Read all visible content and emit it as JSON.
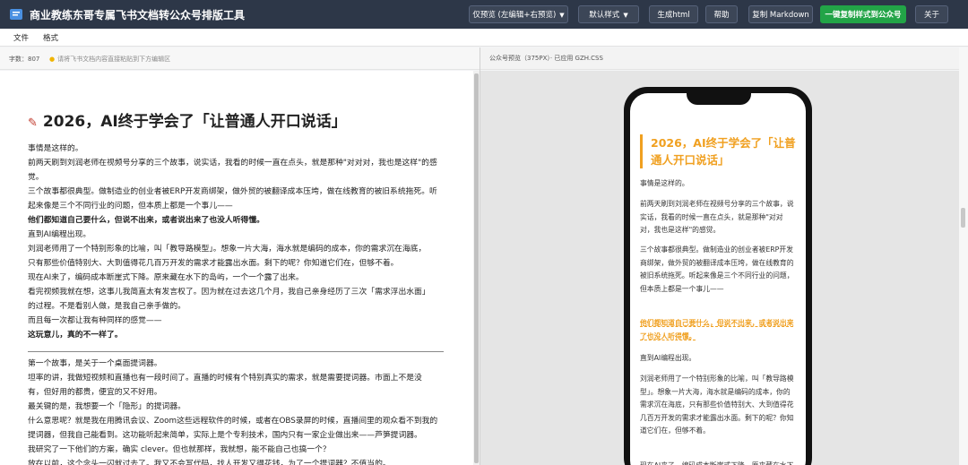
{
  "app": {
    "title": "商业教练东哥专属飞书文档转公众号排版工具"
  },
  "toolbar": {
    "preview_mode": "仅预览 (左编辑+右预览)",
    "style_select": "默认样式",
    "gen_html": "生成html",
    "help": "帮助",
    "copy_markdown": "复制 Markdown",
    "copy_to_wechat": "一键复制样式到公众号",
    "about": "关于"
  },
  "menu": {
    "file": "文件",
    "format": "格式"
  },
  "editor": {
    "word_count": "字数：807",
    "hint": "请将飞书文档内容直接粘贴到下方编辑区",
    "title": "2026，AI终于学会了「让普通人开口说话」",
    "lines_a": [
      {
        "text": "事情是这样的。",
        "bold": false
      },
      {
        "text": "前两天刷到刘润老师在视频号分享的三个故事，说实话，我看的时候一直在点头，就是那种\"对对对，我也是这样\"的感",
        "bold": false
      },
      {
        "text": "觉。",
        "bold": false
      },
      {
        "text": "三个故事都很典型。做制造业的创业者被ERP开发商绑架，做外贸的被翻译成本压垮，做在线教育的被旧系统拖死。听",
        "bold": false
      },
      {
        "text": "起来像是三个不同行业的问题，但本质上都是一个事儿——",
        "bold": false
      },
      {
        "text": "他们都知道自己要什么，但说不出来，或者说出来了也没人听得懂。",
        "bold": true
      },
      {
        "text": "直到AI编程出现。",
        "bold": false
      },
      {
        "text": "刘润老师用了一个特别形象的比喻，叫「教导路模型」。想象一片大海，海水就是编码的成本，你的需求沉在海底，",
        "bold": false
      },
      {
        "text": "只有那些价值特别大、大到值得花几百万开发的需求才能露出水面。剩下的呢？你知道它们在，但够不着。",
        "bold": false
      },
      {
        "text": "现在AI来了，编码成本断崖式下降。原来藏在水下的岛屿，一个一个露了出来。",
        "bold": false
      },
      {
        "text": "看完视频我就在想，这事儿我简直太有发言权了。因为就在过去这几个月，我自己亲身经历了三次「需求浮出水面」",
        "bold": false
      },
      {
        "text": "的过程。不是看别人做，是我自己亲手做的。",
        "bold": false
      },
      {
        "text": "而且每一次都让我有种同样的感觉——",
        "bold": false
      },
      {
        "text": "这玩意儿，真的不一样了。",
        "bold": true
      }
    ],
    "lines_b": [
      {
        "text": "第一个故事，是关于一个桌面提词器。",
        "bold": false
      },
      {
        "text": "坦率的讲，我做短视频和直播也有一段时间了。直播的时候有个特别真实的需求，就是需要提词器。市面上不是没",
        "bold": false
      },
      {
        "text": "有，但好用的都贵，便宜的又不好用。",
        "bold": false
      },
      {
        "text": "最关键的是，我想要一个「隐形」的提词器。",
        "bold": false
      },
      {
        "text": "什么意思呢？就是我在用腾讯会议、Zoom这些远程软件的时候，或者在OBS录屏的时候，直播间里的观众看不到我的",
        "bold": false
      },
      {
        "text": "提词器，但我自己能看到。这功能听起来简单，实际上是个专利技术，国内只有一家企业做出来——芦笋提词器。",
        "bold": false
      },
      {
        "text": "我研究了一下他们的方案，确实 clever。但也就那样，我就想，能不能自己也搞一个？",
        "bold": false
      },
      {
        "text": "放在以前，这个念头一闪就过去了。我又不会写代码，找人开发又得花钱，为了一个提词器？不值当的。",
        "bold": false
      }
    ]
  },
  "preview": {
    "label": "公众号预览（375PX）· 已应用 GZH.CSS",
    "title": "2026，AI终于学会了「让普通人开口说话」",
    "paragraphs": [
      {
        "text": "事情是这样的。",
        "accent": false
      },
      {
        "text": "前两天刷到刘润老师在视频号分享的三个故事，说实话，我看的时候一直在点头，就是那种\"对对对，我也是这样\"的感觉。",
        "accent": false
      },
      {
        "text": "三个故事都很典型。做制造业的创业者被ERP开发商绑架，做外贸的被翻译成本压垮，做在线教育的被旧系统拖死。听起来像是三个不同行业的问题，但本质上都是一个事儿——",
        "accent": false
      },
      {
        "text": "他们都知道自己要什么，但说不出来，或者说出来了也没人听得懂。",
        "accent": true
      },
      {
        "text": "直到AI编程出现。",
        "accent": false
      },
      {
        "text": "刘润老师用了一个特别形象的比喻，叫「教导路模型」。想象一片大海，海水就是编码的成本，你的需求沉在海底，只有那些价值特别大、大到值得花几百万开发的需求才能露出水面。剩下的呢？你知道它们在，但够不着。",
        "accent": false
      },
      {
        "text": "现在AI来了，编码成本断崖式下降。原来藏在水下的岛屿，一个一个露了出来。",
        "accent": false
      }
    ]
  },
  "colors": {
    "topbar": "#2d3748",
    "accent_orange": "#f0a020",
    "primary_green": "#22a447"
  }
}
